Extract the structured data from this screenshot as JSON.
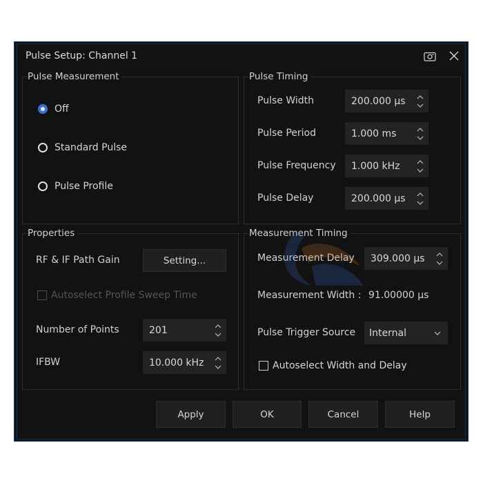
{
  "dialog": {
    "title": "Pulse Setup: Channel 1",
    "camera_icon": "camera-icon",
    "close_icon": "close-icon"
  },
  "pulse_measurement": {
    "label": "Pulse Measurement",
    "options": [
      {
        "label": "Off",
        "checked": true
      },
      {
        "label": "Standard Pulse",
        "checked": false
      },
      {
        "label": "Pulse Profile",
        "checked": false
      }
    ]
  },
  "pulse_timing": {
    "label": "Pulse Timing",
    "fields": [
      {
        "label": "Pulse Width",
        "value": "200.000 µs"
      },
      {
        "label": "Pulse Period",
        "value": "1.000 ms"
      },
      {
        "label": "Pulse Frequency",
        "value": "1.000 kHz"
      },
      {
        "label": "Pulse Delay",
        "value": "200.000 µs"
      }
    ]
  },
  "properties": {
    "label": "Properties",
    "rf_if_gain_label": "RF & IF Path Gain",
    "setting_button": "Setting...",
    "autoselect_sweep_label": "Autoselect Profile Sweep Time",
    "autoselect_sweep_checked": false,
    "autoselect_sweep_enabled": false,
    "num_points_label": "Number of Points",
    "num_points_value": "201",
    "ifbw_label": "IFBW",
    "ifbw_value": "10.000 kHz"
  },
  "measurement_timing": {
    "label": "Measurement Timing",
    "delay_label": "Measurement Delay",
    "delay_value": "309.000 µs",
    "width_label": "Measurement Width :",
    "width_value": "91.00000 µs",
    "trigger_label": "Pulse Trigger Source",
    "trigger_value": "Internal",
    "autoselect_label": "Autoselect Width and Delay",
    "autoselect_checked": false
  },
  "buttons": {
    "apply": "Apply",
    "ok": "OK",
    "cancel": "Cancel",
    "help": "Help"
  },
  "colors": {
    "accent": "#3a6fd0",
    "dialog_bg": "#121212",
    "field_bg": "#232323"
  }
}
